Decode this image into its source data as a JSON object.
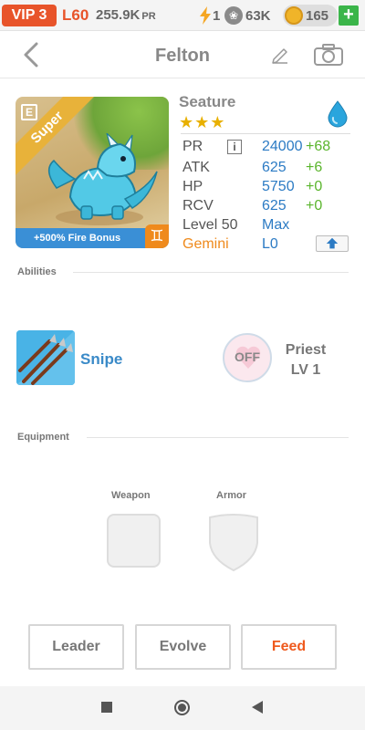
{
  "topbar": {
    "vip": "VIP 3",
    "level": "L60",
    "pr_value": "255.9K",
    "pr_unit": "PR",
    "energy": "1",
    "paws": "63K",
    "coins": "165",
    "add_symbol": "+"
  },
  "header": {
    "title": "Felton"
  },
  "creature": {
    "rarity": "Super",
    "badge_letter": "E",
    "fire_bonus": "+500% Fire Bonus",
    "zodiac_symbol": "♊",
    "name": "Seature",
    "stars": "★★★",
    "element_icon": "water-drop",
    "stats": {
      "pr_label": "PR",
      "pr_value": "24000",
      "pr_bonus": "+68",
      "atk_label": "ATK",
      "atk_value": "625",
      "atk_bonus": "+6",
      "hp_label": "HP",
      "hp_value": "5750",
      "hp_bonus": "+0",
      "rcv_label": "RCV",
      "rcv_value": "625",
      "rcv_bonus": "+0",
      "level_label": "Level 50",
      "level_value": "Max",
      "zodiac_label": "Gemini",
      "zodiac_level": "L0"
    },
    "info_symbol": "i"
  },
  "abilities": {
    "section_label": "Abilities",
    "skill_name": "Snipe",
    "toggle_state": "OFF",
    "class_name": "Priest",
    "class_level": "LV 1"
  },
  "equipment": {
    "section_label": "Equipment",
    "weapon_label": "Weapon",
    "armor_label": "Armor"
  },
  "actions": {
    "leader": "Leader",
    "evolve": "Evolve",
    "feed": "Feed"
  },
  "colors": {
    "accent_orange": "#e8542a",
    "stat_blue": "#2c7bc4",
    "bonus_green": "#5ab52c",
    "feed_orange": "#ef5a1e"
  }
}
